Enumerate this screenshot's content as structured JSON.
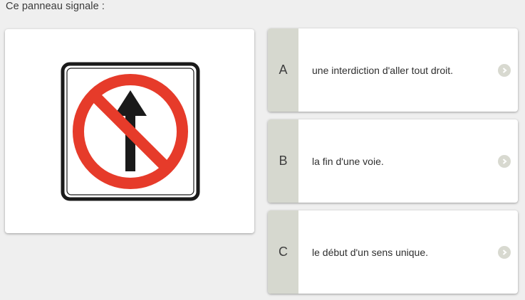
{
  "question": {
    "text": "Ce panneau signale :"
  },
  "image": {
    "icon": "no-straight-ahead-sign-icon",
    "colors": {
      "red": "#e63b2a",
      "arrow": "#1a1a1a",
      "border": "#1a1a1a"
    }
  },
  "options": [
    {
      "letter": "A",
      "text": "une interdiction d'aller tout droit."
    },
    {
      "letter": "B",
      "text": "la fin d'une voie."
    },
    {
      "letter": "C",
      "text": "le début d'un sens unique."
    }
  ],
  "colors": {
    "letter_bg": "#d6d8cf",
    "arrow_bg": "#d8d9d0",
    "page_bg": "#efefef"
  }
}
